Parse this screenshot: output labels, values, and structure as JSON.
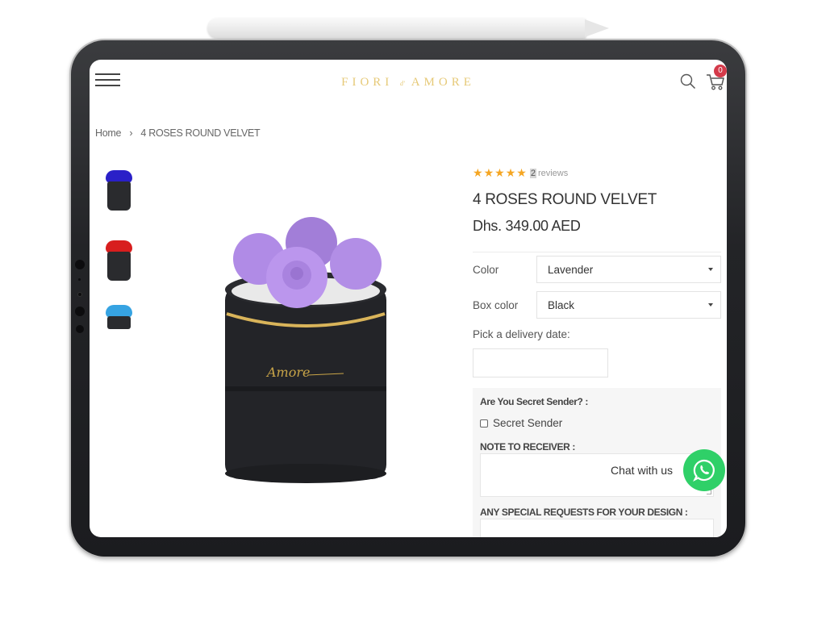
{
  "device": {
    "type": "tablet-mockup"
  },
  "header": {
    "menu_icon": "hamburger-icon",
    "logo_main_left": "FIORI",
    "logo_small": "d'",
    "logo_main_right": "AMORE",
    "search_icon": "search-icon",
    "cart_icon": "cart-icon",
    "cart_count": "0"
  },
  "breadcrumb": {
    "home": "Home",
    "separator": "›",
    "current": "4 ROSES ROUND VELVET"
  },
  "gallery": {
    "thumbnails": [
      {
        "label": "Blue roses",
        "rose_color": "#2a20c8"
      },
      {
        "label": "Red roses",
        "rose_color": "#d81e1e"
      },
      {
        "label": "Light blue roses",
        "rose_color": "#36a3e2"
      }
    ],
    "main_image": {
      "label": "Lavender roses in black velvet box",
      "rose_color": "#b08be6",
      "box_color": "#232428",
      "brand_script": "Amore"
    }
  },
  "product": {
    "rating": 5,
    "review_count": "2",
    "review_label": "reviews",
    "title": "4 ROSES ROUND VELVET",
    "price": "Dhs. 349.00 AED"
  },
  "options": {
    "color_label": "Color",
    "color_value": "Lavender",
    "box_color_label": "Box color",
    "box_color_value": "Black",
    "delivery_label": "Pick a delivery date:",
    "delivery_value": ""
  },
  "form": {
    "secret_question": "Are You Secret Sender? :",
    "secret_checkbox_label": "Secret Sender",
    "secret_checked": false,
    "note_label": "NOTE TO RECEIVER :",
    "note_value": "",
    "requests_label": "ANY SPECIAL REQUESTS FOR YOUR DESIGN :",
    "requests_value": ""
  },
  "chat": {
    "label": "Chat with us",
    "icon": "whatsapp-icon",
    "color": "#2fd068"
  },
  "colors": {
    "logo_gold": "#e6c977",
    "star": "#f5a623",
    "badge": "#d43a4a"
  }
}
